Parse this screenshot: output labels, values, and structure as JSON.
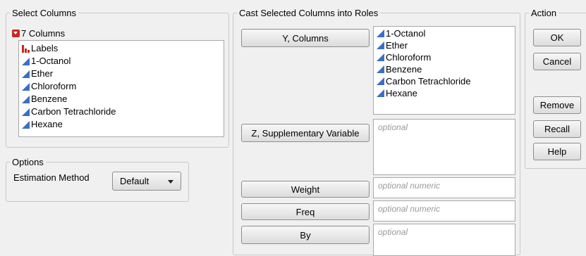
{
  "select_columns": {
    "title": "Select Columns",
    "count_label": "7 Columns",
    "items": [
      {
        "label": "Labels",
        "type": "nominal"
      },
      {
        "label": "1-Octanol",
        "type": "continuous"
      },
      {
        "label": "Ether",
        "type": "continuous"
      },
      {
        "label": "Chloroform",
        "type": "continuous"
      },
      {
        "label": "Benzene",
        "type": "continuous"
      },
      {
        "label": "Carbon Tetrachloride",
        "type": "continuous"
      },
      {
        "label": "Hexane",
        "type": "continuous"
      }
    ]
  },
  "options": {
    "title": "Options",
    "estimation_label": "Estimation Method",
    "estimation_value": "Default"
  },
  "cast": {
    "title": "Cast Selected Columns into Roles",
    "y_button": "Y, Columns",
    "y_items": [
      "1-Octanol",
      "Ether",
      "Chloroform",
      "Benzene",
      "Carbon Tetrachloride",
      "Hexane"
    ],
    "z_button": "Z, Supplementary Variable",
    "z_placeholder": "optional",
    "weight_button": "Weight",
    "weight_placeholder": "optional numeric",
    "freq_button": "Freq",
    "freq_placeholder": "optional numeric",
    "by_button": "By",
    "by_placeholder": "optional"
  },
  "action": {
    "title": "Action",
    "ok": "OK",
    "cancel": "Cancel",
    "remove": "Remove",
    "recall": "Recall",
    "help": "Help"
  },
  "colors": {
    "continuous_icon": "#3b6fc4",
    "nominal_icon": "#c8281e",
    "placeholder_text": "#9a9a9a"
  }
}
